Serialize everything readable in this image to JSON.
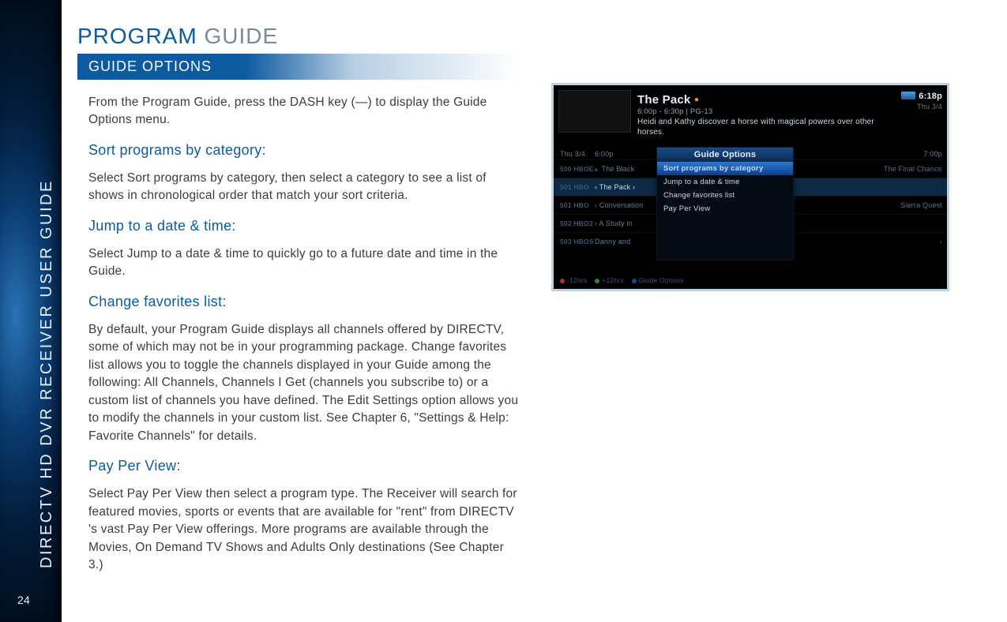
{
  "rail": {
    "vertical_title": "DIRECTV HD DVR RECEIVER USER GUIDE",
    "page_number": "24"
  },
  "page_title": {
    "w1": "PROGRAM",
    "w2": "GUIDE"
  },
  "section_bar": "GUIDE OPTIONS",
  "body": {
    "intro": "From the Program Guide, press the DASH key (—) to display the Guide Options menu.",
    "h1": "Sort programs by category:",
    "p1": "Select Sort programs by category, then select a category to see a list of shows in chronological order that match your sort criteria.",
    "h2": "Jump to a date & time:",
    "p2": "Select Jump to a date & time to quickly go to a future date and time in the Guide.",
    "h3": "Change favorites list:",
    "p3": "By default, your Program Guide displays all channels offered by DIRECTV, some of which may not be in your programming package.  Change favorites list allows you to toggle the channels displayed in your Guide among the following:  All Channels, Channels I Get (channels you subscribe to) or a custom list of channels you have defined. The Edit Settings option allows you to modify the channels in your custom list. See Chapter 6, \"Settings & Help: Favorite Channels\" for details.",
    "h4": "Pay Per View:",
    "p4": "Select Pay Per View then select a program type. The Receiver will search for featured movies, sports or events that are available for \"rent\" from DIRECTV 's vast Pay Per View offerings. More programs are available through the Movies, On Demand TV Shows and Adults Only destinations (See Chapter 3.)"
  },
  "screenshot": {
    "clock_time": "6:18p",
    "clock_date": "Thu 3/4",
    "title": "The Pack",
    "meta": "6:00p - 6:30p | PG-13",
    "desc": "Heidi and Kathy discover a horse with magical powers over other horses.",
    "grid_head": {
      "date": "Thu 3/4",
      "t1": "6:00p",
      "t2": "7:00p"
    },
    "rows": [
      {
        "ch": "500 HBOE",
        "prog": "The Black",
        "prog2": "The Final Chance"
      },
      {
        "ch": "501 HBO",
        "prog": "‹ The Pack ›",
        "prog2": ""
      },
      {
        "ch": "501 HBO",
        "prog": "‹ Conversation",
        "prog2": "Sierra Quest"
      },
      {
        "ch": "502 HBO2",
        "prog": "‹ A Study in",
        "prog2": ""
      },
      {
        "ch": "503 HBOS",
        "prog": "Danny and",
        "prog2": "›"
      }
    ],
    "foot": {
      "a": "-12hrs",
      "b": "+12hrs",
      "c": "Guide Options"
    },
    "popup": {
      "head": "Guide Options",
      "items": [
        "Sort programs by category",
        "Jump to a date & time",
        "Change favorites list",
        "Pay Per View"
      ]
    }
  }
}
